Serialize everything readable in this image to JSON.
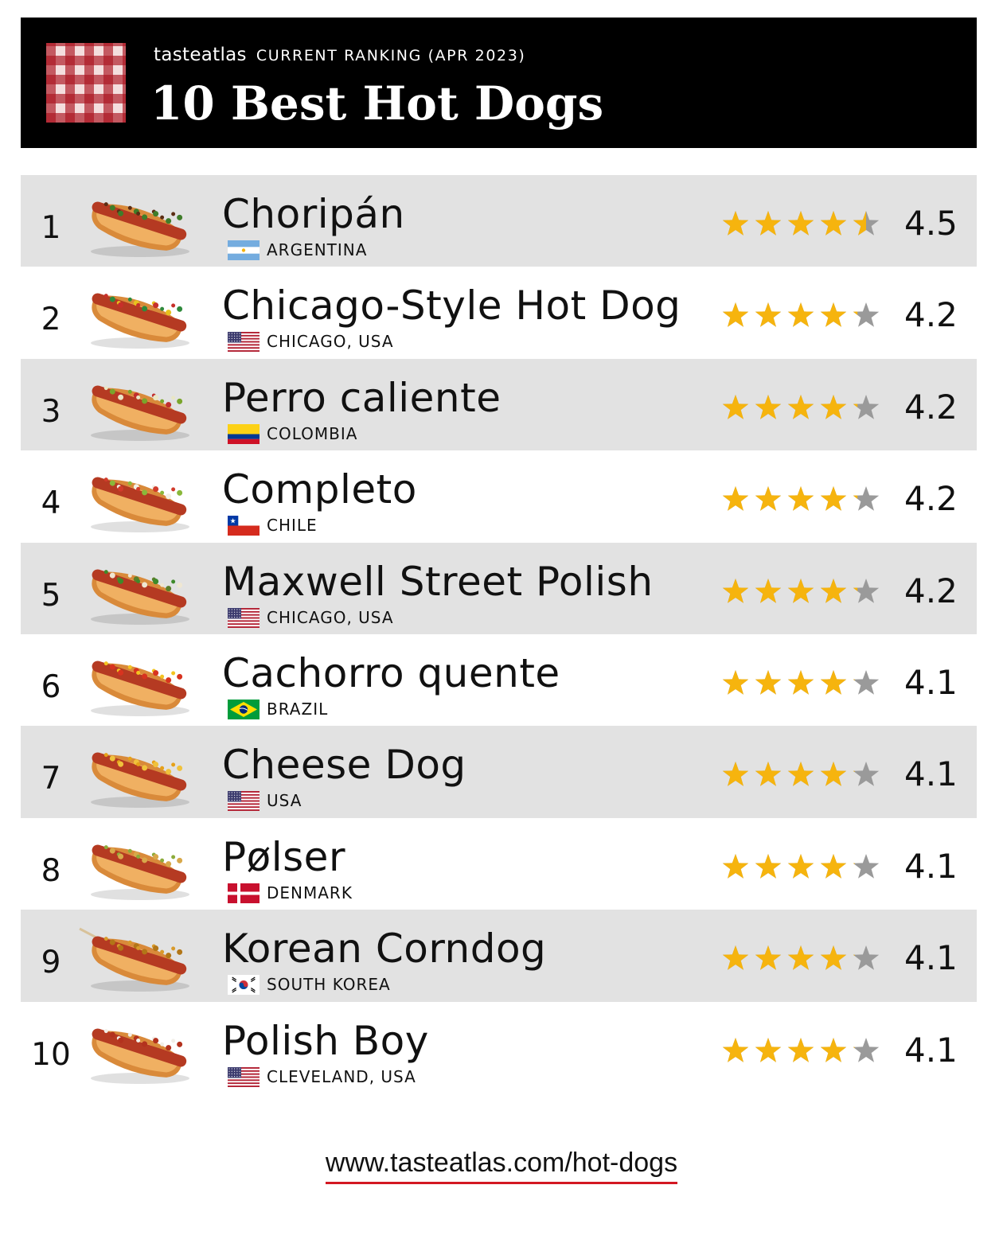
{
  "header": {
    "brand": "tasteatlas",
    "subtitle": "CURRENT RANKING (APR 2023)",
    "title": "10 Best Hot Dogs"
  },
  "colors": {
    "star_fill": "#f6b40e",
    "star_empty": "#9a9a9a",
    "accent_underline": "#d31822",
    "header_bg": "#000000"
  },
  "items": [
    {
      "rank": "1",
      "name": "Choripán",
      "country": "ARGENTINA",
      "flag": "argentina",
      "rating": "4.5",
      "stars": 4.5
    },
    {
      "rank": "2",
      "name": "Chicago-Style Hot Dog",
      "country": "CHICAGO, USA",
      "flag": "usa",
      "rating": "4.2",
      "stars": 4.2
    },
    {
      "rank": "3",
      "name": "Perro caliente",
      "country": "COLOMBIA",
      "flag": "colombia",
      "rating": "4.2",
      "stars": 4.2
    },
    {
      "rank": "4",
      "name": "Completo",
      "country": "CHILE",
      "flag": "chile",
      "rating": "4.2",
      "stars": 4.2
    },
    {
      "rank": "5",
      "name": "Maxwell Street Polish",
      "country": "CHICAGO, USA",
      "flag": "usa",
      "rating": "4.2",
      "stars": 4.2
    },
    {
      "rank": "6",
      "name": "Cachorro quente",
      "country": "BRAZIL",
      "flag": "brazil",
      "rating": "4.1",
      "stars": 4.1
    },
    {
      "rank": "7",
      "name": "Cheese Dog",
      "country": "USA",
      "flag": "usa",
      "rating": "4.1",
      "stars": 4.1
    },
    {
      "rank": "8",
      "name": "Pølser",
      "country": "DENMARK",
      "flag": "denmark",
      "rating": "4.1",
      "stars": 4.1
    },
    {
      "rank": "9",
      "name": "Korean Corndog",
      "country": "SOUTH KOREA",
      "flag": "south-korea",
      "rating": "4.1",
      "stars": 4.1
    },
    {
      "rank": "10",
      "name": "Polish Boy",
      "country": "CLEVELAND, USA",
      "flag": "usa",
      "rating": "4.1",
      "stars": 4.1
    }
  ],
  "footer": {
    "url": "www.tasteatlas.com/hot-dogs"
  }
}
